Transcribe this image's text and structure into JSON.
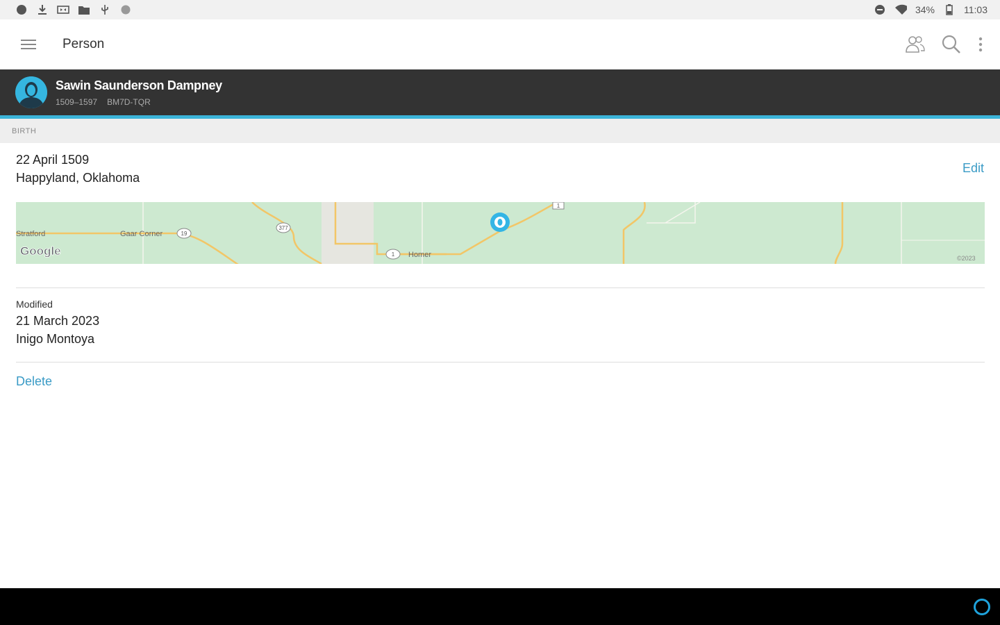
{
  "status_bar": {
    "battery": "34%",
    "time": "11:03"
  },
  "app_bar": {
    "title": "Person"
  },
  "person": {
    "name": "Sawin Saunderson Dampney",
    "lifespan": "1509–1597",
    "id": "BM7D-TQR"
  },
  "section": {
    "label": "BIRTH"
  },
  "birth": {
    "date": "22 April 1509",
    "place": "Happyland, Oklahoma",
    "edit_label": "Edit"
  },
  "map": {
    "places": [
      "Stratford",
      "Gaar Corner",
      "Homer"
    ],
    "route_numbers": [
      "19",
      "377",
      "1",
      "1"
    ],
    "logo": "Google",
    "copyright": "©2023",
    "colors": {
      "land": "#cde9d0",
      "road": "#f2c667",
      "marker": "#33b5e5"
    }
  },
  "modified": {
    "label": "Modified",
    "date": "21 March 2023",
    "user": "Inigo Montoya"
  },
  "actions": {
    "delete_label": "Delete"
  },
  "colors": {
    "accent": "#3cb4d9",
    "link": "#3a9bc6",
    "header_bg": "#333333"
  }
}
